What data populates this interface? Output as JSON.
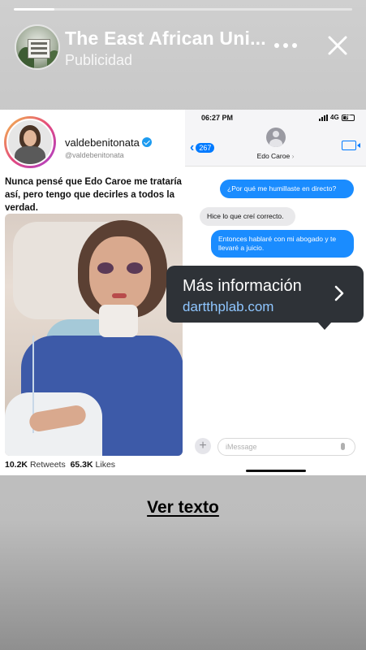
{
  "story": {
    "progress_fraction": 0.12
  },
  "header": {
    "title": "The East African Uni...",
    "subtitle": "Publicidad",
    "more_icon": "more-dots-icon",
    "close_icon": "close-icon"
  },
  "ad": {
    "tweet": {
      "name": "valdebenitonata",
      "handle": "@valdebenitonata",
      "text": "Nunca pensé que Edo Caroe me trataría así, pero tengo que decirles a todos la verdad.",
      "retweets": "10.2K",
      "retweets_label": "Retweets",
      "likes": "65.3K",
      "likes_label": "Likes"
    },
    "imessage": {
      "time": "06:27 PM",
      "network": "4G",
      "battery": "35",
      "back_count": "267",
      "contact": "Edo Caroe",
      "messages": [
        {
          "dir": "out",
          "text": "¿Por qué me humillaste en directo?"
        },
        {
          "dir": "in",
          "text": "Hice lo que creí correcto."
        },
        {
          "dir": "out",
          "text": "Entonces hablaré con mi abogado y te llevaré a juicio."
        }
      ],
      "input_placeholder": "iMessage"
    }
  },
  "tooltip": {
    "title": "Más información",
    "url": "dartthplab.com"
  },
  "cta": {
    "label": "Ver texto"
  },
  "colors": {
    "imessage_blue": "#1a8cff",
    "tooltip_bg": "#2e3237",
    "link_blue": "#8fc6ff"
  }
}
